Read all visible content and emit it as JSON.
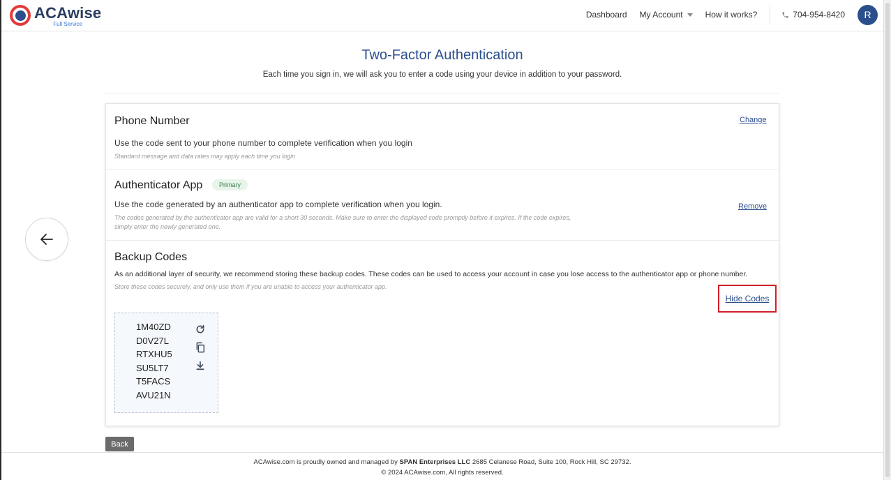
{
  "header": {
    "logo_name": "ACAwise",
    "logo_sub": "Full Service",
    "nav": {
      "dashboard": "Dashboard",
      "my_account": "My Account",
      "how_it_works": "How it works?",
      "phone": "704-954-8420",
      "avatar_initial": "R"
    }
  },
  "page": {
    "title": "Two-Factor Authentication",
    "subtitle": "Each time you sign in, we will ask you to enter a code using your device in addition to your password."
  },
  "phone_section": {
    "title": "Phone Number",
    "description": "Use the code sent to your phone number to complete verification when you login",
    "note": "Standard message and data rates may apply each time you login",
    "action": "Change"
  },
  "auth_app_section": {
    "title": "Authenticator App",
    "badge": "Primary",
    "description": "Use the code generated by an authenticator app to complete verification when you login.",
    "note_line1": "The codes generated by the authenticator app are valid for a short 30 seconds. Make sure to enter the displayed code promptly before it expires. If the code expires,",
    "note_line2": "simply enter the newly generated one.",
    "action": "Remove"
  },
  "backup_section": {
    "title": "Backup Codes",
    "description": "As an additional layer of security, we recommend storing these backup codes. These codes can be used to access your account in case you lose access to the authenticator app or phone number.",
    "note": "Store these codes securely, and only use them if you are unable to access your authenticator app.",
    "action": "Hide Codes",
    "codes": [
      "1M40ZD",
      "D0V27L",
      "RTXHU5",
      "SU5LT7",
      "T5FACS",
      "AVU21N"
    ],
    "highlight_color": "#d21f2a"
  },
  "back_button": "Back",
  "footer": {
    "line1_prefix": "ACAwise.com is proudly owned and managed by ",
    "line1_company": "SPAN Enterprises LLC",
    "line1_suffix": " 2685 Celanese Road, Suite 100, Rock Hill, SC 29732.",
    "line2": "© 2024 ACAwise.com, All rights reserved."
  },
  "colors": {
    "brand_blue": "#2b4f8d",
    "brand_red": "#e03b3b"
  }
}
